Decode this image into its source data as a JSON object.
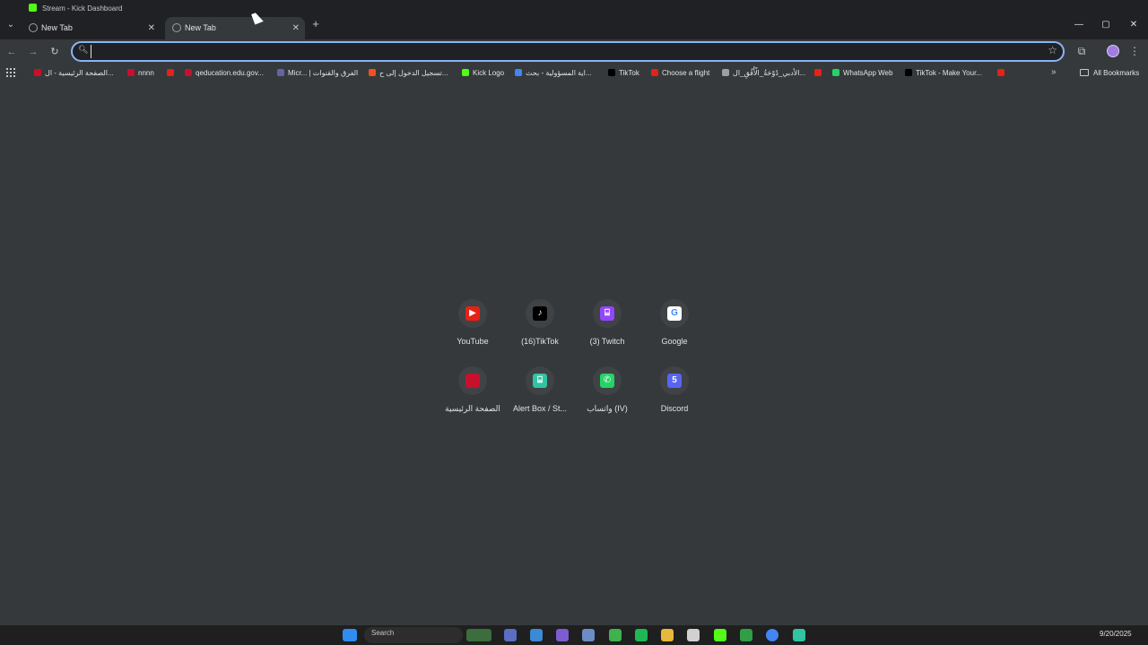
{
  "ghost_tab": {
    "title": "Stream - Kick Dashboard"
  },
  "tabs": [
    {
      "title": "New Tab",
      "active": false
    },
    {
      "title": "New Tab",
      "active": true
    }
  ],
  "window_controls": {
    "minimize": "—",
    "restore": "▢",
    "close": "✕"
  },
  "omnibox": {
    "value": "",
    "placeholder": ""
  },
  "bookmarks": [
    {
      "label": "الصفحة الرئيسية - ال...",
      "color": "#c8102e"
    },
    {
      "label": "nnnn",
      "color": "#c8102e"
    },
    {
      "label": "",
      "color": "#e62117"
    },
    {
      "label": "qeducation.edu.gov...",
      "color": "#c8102e"
    },
    {
      "label": "Micr... | الفرق والقنوات",
      "color": "#6264a7"
    },
    {
      "label": "تسجيل الدخول إلى ح...",
      "color": "#f25022"
    },
    {
      "label": "Kick Logo",
      "color": "#53fc18"
    },
    {
      "label": "اية المسؤولية - بحث...",
      "color": "#4285f4"
    },
    {
      "label": "TikTok",
      "color": "#000000"
    },
    {
      "label": "Choose a flight",
      "color": "#e2231a"
    },
    {
      "label": "الأدبي_دُوْحَةُ_الْأُفُقِ_ال...",
      "color": "#9aa0a6"
    },
    {
      "label": "",
      "color": "#e62117"
    },
    {
      "label": "WhatsApp Web",
      "color": "#25d366"
    },
    {
      "label": "TikTok - Make Your...",
      "color": "#000000"
    },
    {
      "label": "",
      "color": "#e62117"
    }
  ],
  "bookmarks_more": "»",
  "all_bookmarks": "All Bookmarks",
  "shortcuts": [
    {
      "label": "YouTube",
      "color": "#e62117",
      "glyph": "▶"
    },
    {
      "label": "(16)TikTok",
      "color": "#000000",
      "glyph": "♪"
    },
    {
      "label": "(3) Twitch",
      "color": "#9146ff",
      "glyph": "⌸"
    },
    {
      "label": "Google",
      "color": "#ffffff",
      "glyph": "G"
    },
    {
      "label": "الصفحة الرئيسية",
      "color": "#c8102e",
      "glyph": ""
    },
    {
      "label": "Alert Box / St...",
      "color": "#31c3a2",
      "glyph": "⌸"
    },
    {
      "label": "واتساب (IV)",
      "color": "#25d366",
      "glyph": "✆"
    },
    {
      "label": "Discord",
      "color": "#5865f2",
      "glyph": "5"
    }
  ],
  "taskbar": {
    "search_label": "Search",
    "date": "9/20/2025"
  }
}
